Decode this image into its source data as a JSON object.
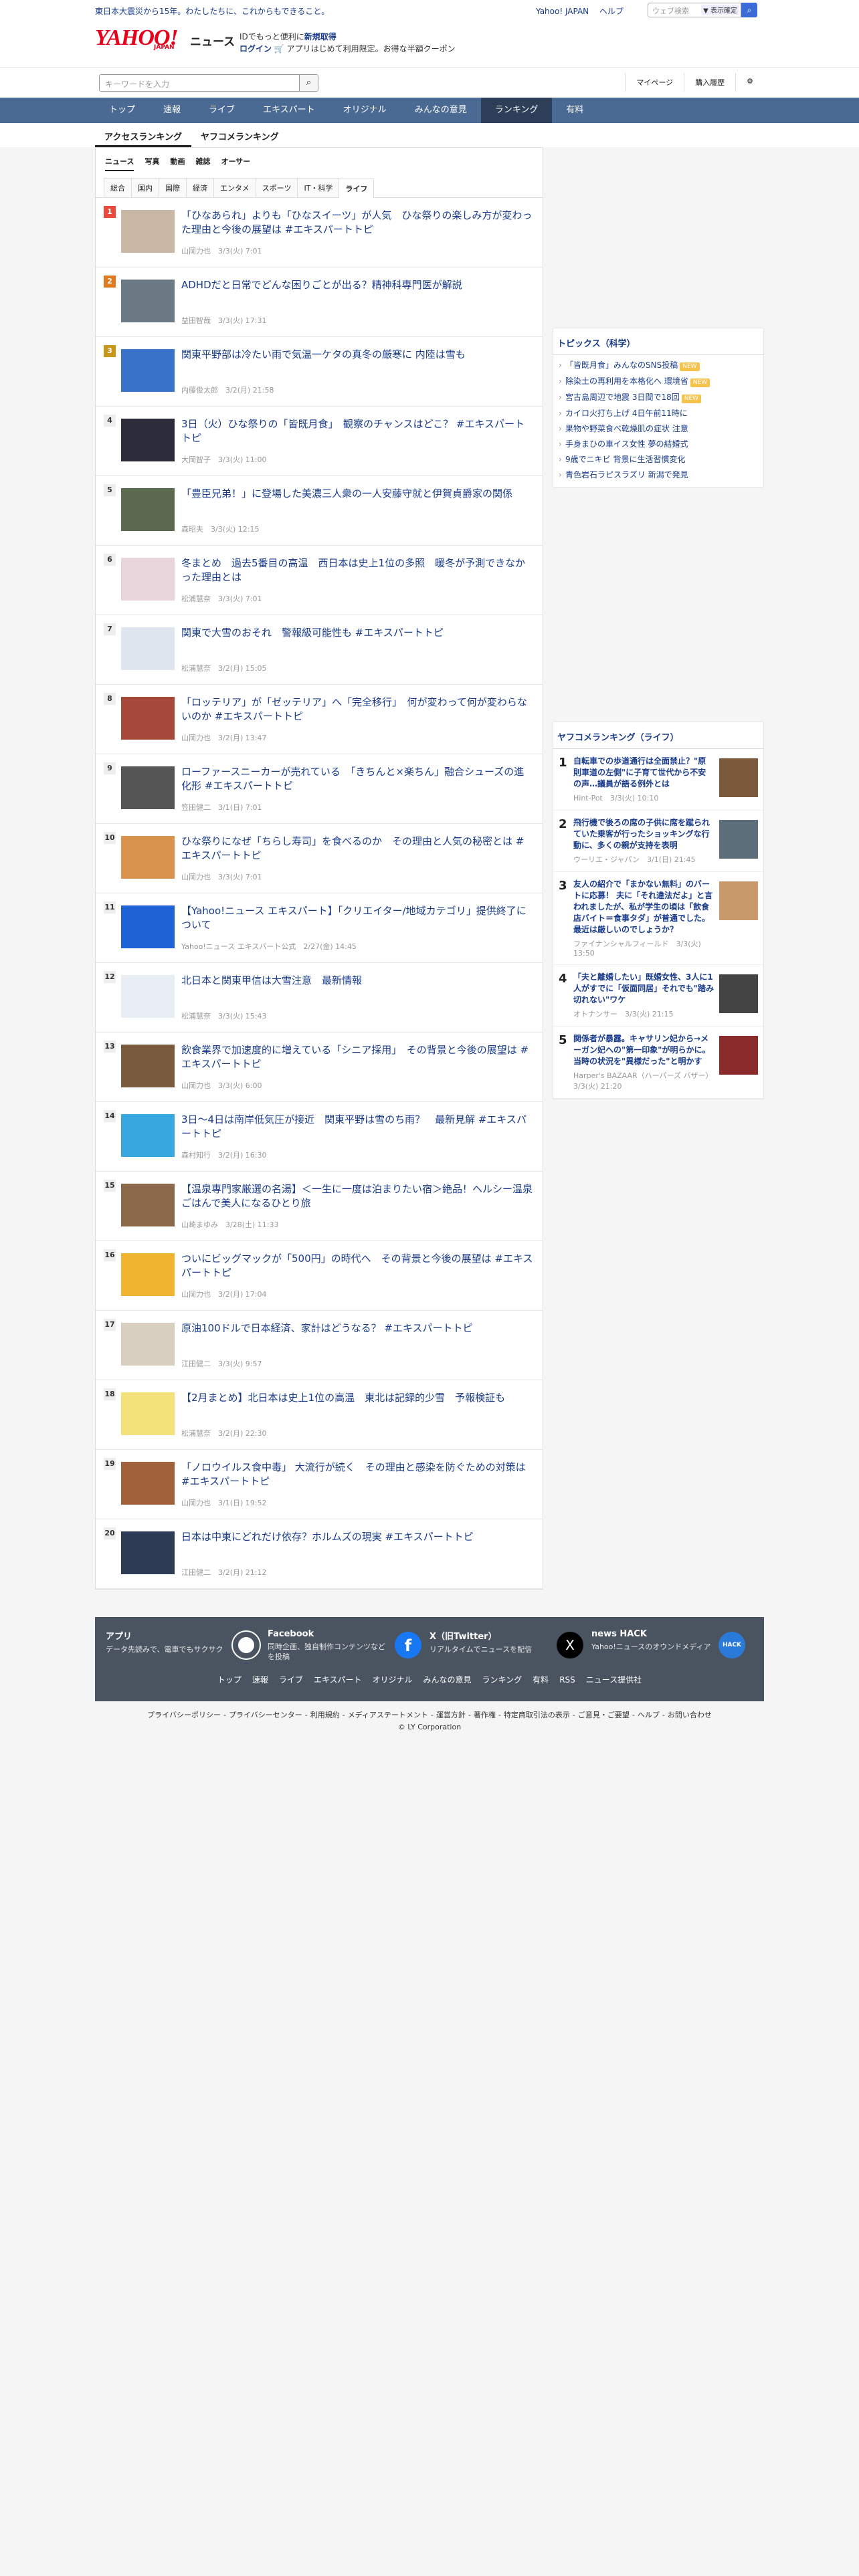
{
  "topbar": {
    "message": "東日本大震災から15年。わたしたちに、これからもできること。",
    "links": [
      "Yahoo! JAPAN",
      "ヘルプ"
    ],
    "search_placeholder": "ウェブ検索",
    "search_chip": "▼ 表示確定"
  },
  "header": {
    "logo_text": "YAHOO!",
    "logo_sub": "JAPAN",
    "logo_section": "ニュース",
    "promo_line1_a": "IDでもっと便利に",
    "promo_line1_b": "新規取得",
    "promo_line2_a": "ログイン",
    "promo_line2_b": "アプリはじめて利用限定。お得な半額クーポン"
  },
  "search": {
    "placeholder": "キーワードを入力",
    "right_links": [
      "マイページ",
      "購入履歴"
    ]
  },
  "nav": {
    "items": [
      "トップ",
      "速報",
      "ライブ",
      "エキスパート",
      "オリジナル",
      "みんなの意見",
      "ランキング",
      "有料"
    ],
    "active": "ランキング"
  },
  "subtabs": {
    "items": [
      "アクセスランキング",
      "ヤフコメランキング"
    ]
  },
  "categories": [
    "ニュース",
    "写真",
    "動画",
    "雑誌",
    "オーサー"
  ],
  "genres": [
    "総合",
    "国内",
    "国際",
    "経済",
    "エンタメ",
    "スポーツ",
    "IT・科学",
    "ライフ"
  ],
  "ranking": [
    {
      "rank": "1",
      "title": "「ひなあられ」よりも「ひなスイーツ」が人気　ひな祭りの楽しみ方が変わった理由と今後の展望は #エキスパートトピ",
      "meta": "山岡力也　3/3(火) 7:01",
      "color": "#c9b8a6"
    },
    {
      "rank": "2",
      "title": "ADHDだと日常でどんな困りごとが出る？精神科専門医が解説",
      "meta": "益田智哉　3/3(火) 17:31",
      "color": "#6c7a86"
    },
    {
      "rank": "3",
      "title": "関東平野部は冷たい雨で気温一ケタの真冬の厳寒に 内陸は雪も",
      "meta": "内藤俊太郎　3/2(月) 21:58",
      "color": "#3a74c8"
    },
    {
      "rank": "4",
      "title": "3日（火）ひな祭りの「皆既月食」　観察のチャンスはどこ？ #エキスパートトピ",
      "meta": "大岡智子　3/3(火) 11:00",
      "color": "#2b2b3a"
    },
    {
      "rank": "5",
      "title": "「豊臣兄弟！」に登場した美濃三人衆の一人安藤守就と伊賀貞爵家の関係",
      "meta": "森昭夫　3/3(火) 12:15",
      "color": "#5b6a4e"
    },
    {
      "rank": "6",
      "title": "冬まとめ　過去5番目の高温　西日本は史上1位の多照　暖冬が予測できなかった理由とは",
      "meta": "松浦慧奈　3/3(火) 7:01",
      "color": "#e8d6dc"
    },
    {
      "rank": "7",
      "title": "関東で大雪のおそれ　警報級可能性も #エキスパートトピ",
      "meta": "松浦慧奈　3/2(月) 15:05",
      "color": "#dfe6f0"
    },
    {
      "rank": "8",
      "title": "「ロッテリア」が「ゼッテリア」へ「完全移行」　何が変わって何が変わらないのか #エキスパートトピ",
      "meta": "山岡力也　3/2(月) 13:47",
      "color": "#a6483a"
    },
    {
      "rank": "9",
      "title": "ローファースニーカーが売れている　「きちんと×楽ちん」融合シューズの進化形 #エキスパートトピ",
      "meta": "笠田健二　3/1(日) 7:01",
      "color": "#555555"
    },
    {
      "rank": "10",
      "title": "ひな祭りになぜ「ちらし寿司」を食べるのか　その理由と人気の秘密とは #エキスパートトピ",
      "meta": "山岡力也　3/3(火) 7:01",
      "color": "#d8924e"
    },
    {
      "rank": "11",
      "title": "【Yahoo!ニュース エキスパート】「クリエイター/地域カテゴリ」提供終了について",
      "meta": "Yahoo!ニュース エキスパート公式　2/27(金) 14:45",
      "color": "#1f62d6"
    },
    {
      "rank": "12",
      "title": "北日本と関東甲信は大雪注意　最新情報",
      "meta": "松浦慧奈　3/3(火) 15:43",
      "color": "#e9eef4"
    },
    {
      "rank": "13",
      "title": "飲食業界で加速度的に増えている「シニア採用」　その背景と今後の展望は #エキスパートトピ",
      "meta": "山岡力也　3/3(火) 6:00",
      "color": "#7a5b3e"
    },
    {
      "rank": "14",
      "title": "3日〜4日は南岸低気圧が接近　関東平野は雪のち雨？　最新見解 #エキスパートトピ",
      "meta": "森村知行　3/2(月) 16:30",
      "color": "#3aa8e0"
    },
    {
      "rank": "15",
      "title": "【温泉専門家厳選の名湯】＜一生に一度は泊まりたい宿＞絶品！ヘルシー温泉ごはんで美人になるひとり旅",
      "meta": "山崎まゆみ　3/28(土) 11:33",
      "color": "#8a6a4a"
    },
    {
      "rank": "16",
      "title": "ついにビッグマックが「500円」の時代へ　その背景と今後の展望は #エキスパートトピ",
      "meta": "山岡力也　3/2(月) 17:04",
      "color": "#f0b430"
    },
    {
      "rank": "17",
      "title": "原油100ドルで日本経済、家計はどうなる？ #エキスパートトピ",
      "meta": "江田健二　3/3(火) 9:57",
      "color": "#d9cfc0"
    },
    {
      "rank": "18",
      "title": "【2月まとめ】北日本は史上1位の高温　東北は記録的少雪　予報検証も",
      "meta": "松浦慧奈　3/2(月) 22:30",
      "color": "#f3e27a"
    },
    {
      "rank": "19",
      "title": "「ノロウイルス食中毒」 大流行が続く　その理由と感染を防ぐための対策は #エキスパートトピ",
      "meta": "山岡力也　3/1(日) 19:52",
      "color": "#a0603a"
    },
    {
      "rank": "20",
      "title": "日本は中東にどれだけ依存？ホルムズの現実 #エキスパートトピ",
      "meta": "江田健二　3/2(月) 21:12",
      "color": "#2e3b55"
    }
  ],
  "topics": {
    "heading": "トピックス（科学）",
    "items": [
      {
        "text": "「皆既月食」みんなのSNS投稿",
        "tag": "NEW"
      },
      {
        "text": "除染土の再利用を本格化へ 環境省",
        "tag": "NEW"
      },
      {
        "text": "宮古島周辺で地震 3日間で18回",
        "tag": "NEW"
      },
      {
        "text": "カイロ火打ち上げ 4日午前11時に",
        "tag": ""
      },
      {
        "text": "果物や野菜食べ乾燥肌の症状 注意",
        "tag": ""
      },
      {
        "text": "手身まひの車イス女性 夢の結婚式",
        "tag": ""
      },
      {
        "text": "9歳でニキビ 背景に生活習慣変化",
        "tag": ""
      },
      {
        "text": "青色岩石ラピスラズリ 新潟で発見",
        "tag": ""
      }
    ]
  },
  "yafcome": {
    "heading": "ヤフコメランキング（ライフ）",
    "items": [
      {
        "rank": "1",
        "title": "自転車での歩道通行は全面禁止？\"原則車道の左側\"に子育て世代から不安の声…議員が語る例外とは",
        "meta": "Hint-Pot　3/3(火) 10:10",
        "color": "#7a5a3a"
      },
      {
        "rank": "2",
        "title": "飛行機で後ろの席の子供に席を蹴られていた乗客が行ったショッキングな行動に、多くの親が支持を表明",
        "meta": "ウーリエ・ジャパン　3/1(日) 21:45",
        "color": "#5b6e7a"
      },
      {
        "rank": "3",
        "title": "友人の紹介で「まかない無料」のバートに応募！ 夫に「それ違法だよ」と言われましたが、私が学生の頃は「飲食店バイト＝食事タダ」が普通でした。最近は厳しいのでしょうか？",
        "meta": "ファイナンシャルフィールド　3/3(火) 13:50",
        "color": "#c89a6a"
      },
      {
        "rank": "4",
        "title": "「夫と離婚したい」既婚女性、3人に1人がすでに「仮面同居」それでも\"踏み切れない\"ワケ",
        "meta": "オトナンサー　3/3(火) 21:15",
        "color": "#444444"
      },
      {
        "rank": "5",
        "title": "関係者が暴露。キャサリン妃から→メーガン妃への\"第一印象\"が明らかに。当時の状況を\"異様だった\"と明かす",
        "meta": "Harper's BAZAAR（ハーパーズ バザー）　3/3(火) 21:20",
        "color": "#8a2a2a"
      }
    ]
  },
  "footer": {
    "apps": [
      {
        "title": "アプリ",
        "desc": "データ先読みで、電車でもサクサク"
      },
      {
        "title": "Facebook",
        "desc": "同時企画、独自制作コンテンツなどを投稿"
      },
      {
        "title": "X（旧Twitter）",
        "desc": "リアルタイムでニュースを配信"
      },
      {
        "title": "news HACK",
        "desc": "Yahoo!ニュースのオウンドメディア"
      }
    ],
    "links": [
      "トップ",
      "速報",
      "ライブ",
      "エキスパート",
      "オリジナル",
      "みんなの意見",
      "ランキング",
      "有料",
      "RSS",
      "ニュース提供社"
    ],
    "legal_links": [
      "プライバシーポリシー",
      "プライバシーセンター",
      "利用規約",
      "メディアステートメント",
      "運営方針",
      "著作権",
      "特定商取引法の表示",
      "ご意見・ご要望",
      "ヘルプ",
      "お問い合わせ"
    ],
    "copyright": "© LY Corporation"
  }
}
